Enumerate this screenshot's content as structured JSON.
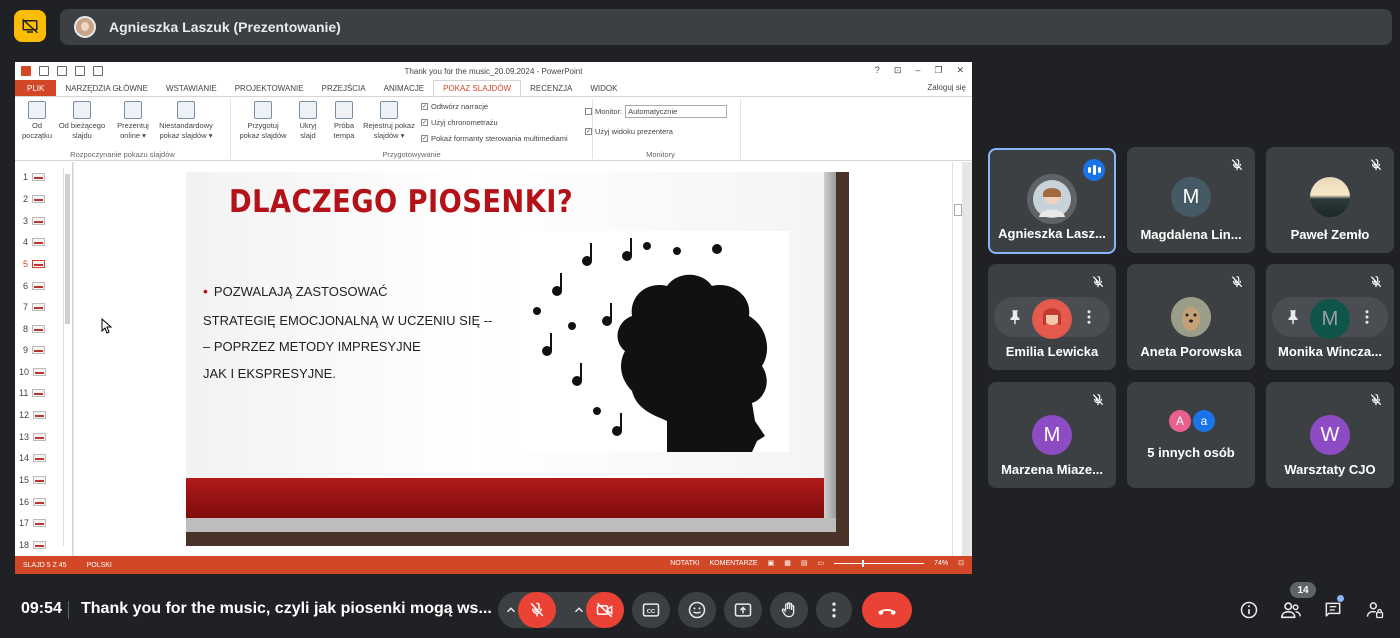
{
  "presenter": {
    "name": "Agnieszka Laszuk (Prezentowanie)"
  },
  "powerpoint": {
    "doc_title": "Thank you for the music_20.09.2024 - PowerPoint",
    "window_controls": [
      "?",
      "⊡",
      "–",
      "❐",
      "✕"
    ],
    "login": "Zaloguj się",
    "tabs": [
      "PLIK",
      "NARZĘDZIA GŁÓWNE",
      "WSTAWIANIE",
      "PROJEKTOWANIE",
      "PRZEJŚCIA",
      "ANIMACJE",
      "POKAZ SLAJDÓW",
      "RECENZJA",
      "WIDOK"
    ],
    "active_tab": "POKAZ SLAJDÓW",
    "ribbon": {
      "group1_label": "Rozpoczynanie pokazu slajdów",
      "btn_od_poczatku": [
        "Od",
        "początku"
      ],
      "btn_od_biezacego": [
        "Od bieżącego",
        "slajdu"
      ],
      "btn_prezentuj": [
        "Prezentuj",
        "online ▾"
      ],
      "btn_niestandardowy": [
        "Niestandardowy",
        "pokaz slajdów ▾"
      ],
      "group2_label": "Przygotowywanie",
      "btn_przygotuj": [
        "Przygotuj",
        "pokaz slajdów"
      ],
      "btn_ukryj": [
        "Ukryj",
        "slajd"
      ],
      "btn_proba": [
        "Próba",
        "tempa"
      ],
      "btn_rejestruj": [
        "Rejestruj pokaz",
        "slajdów ▾"
      ],
      "check1": "Odtwórz narracje",
      "check2": "Użyj chronometrażu",
      "check3": "Pokaż formanty sterowania multimediami",
      "group3_label": "Monitory",
      "monitor_label": "Monitor:",
      "monitor_value": "Automatycznie",
      "check4": "Użyj widoku prezentera"
    },
    "thumbnails": [
      "1",
      "2",
      "3",
      "4",
      "5",
      "6",
      "7",
      "8",
      "9",
      "10",
      "11",
      "12",
      "13",
      "14",
      "15",
      "16",
      "17",
      "18"
    ],
    "active_slide": "5",
    "slide": {
      "title": "DLACZEGO PIOSENKI?",
      "line1": "POZWALAJĄ ZASTOSOWAĆ",
      "line2": "STRATEGIĘ EMOCJONALNĄ W UCZENIU SIĘ  --",
      "line3": "– POPRZEZ METODY IMPRESYJNE",
      "line4": "JAK I EKSPRESYJNE."
    },
    "status": {
      "slide_count": "SLAJD 5 Z 45",
      "language": "POLSKI",
      "notes": "NOTATKI",
      "comments": "KOMENTARZE",
      "zoom": "74%"
    }
  },
  "participants": [
    {
      "name": "Agnieszka Lasz...",
      "initial": "",
      "speaking": true
    },
    {
      "name": "Magdalena Lin...",
      "initial": "M",
      "muted": true
    },
    {
      "name": "Paweł Zemło",
      "initial": "",
      "muted": true
    },
    {
      "name": "Emilia Lewicka",
      "initial": "",
      "muted": true
    },
    {
      "name": "Aneta Porowska",
      "initial": "",
      "muted": true
    },
    {
      "name": "Monika Wincza...",
      "initial": "M",
      "muted": true
    },
    {
      "name": "Marzena Miaze...",
      "initial": "M",
      "muted": true
    },
    {
      "name": "5 innych osób",
      "initial_a": "A",
      "initial_b": "a"
    },
    {
      "name": "Warsztaty CJO",
      "initial": "W",
      "muted": true
    }
  ],
  "bottom": {
    "time": "09:54",
    "meeting_title": "Thank you for the music, czyli jak piosenki mogą ws...",
    "people_count": "14"
  },
  "colors": {
    "accent_blue": "#1a73e8",
    "red": "#ea4335",
    "pp_orange": "#d24726",
    "tile_bg": "#3c4043"
  }
}
